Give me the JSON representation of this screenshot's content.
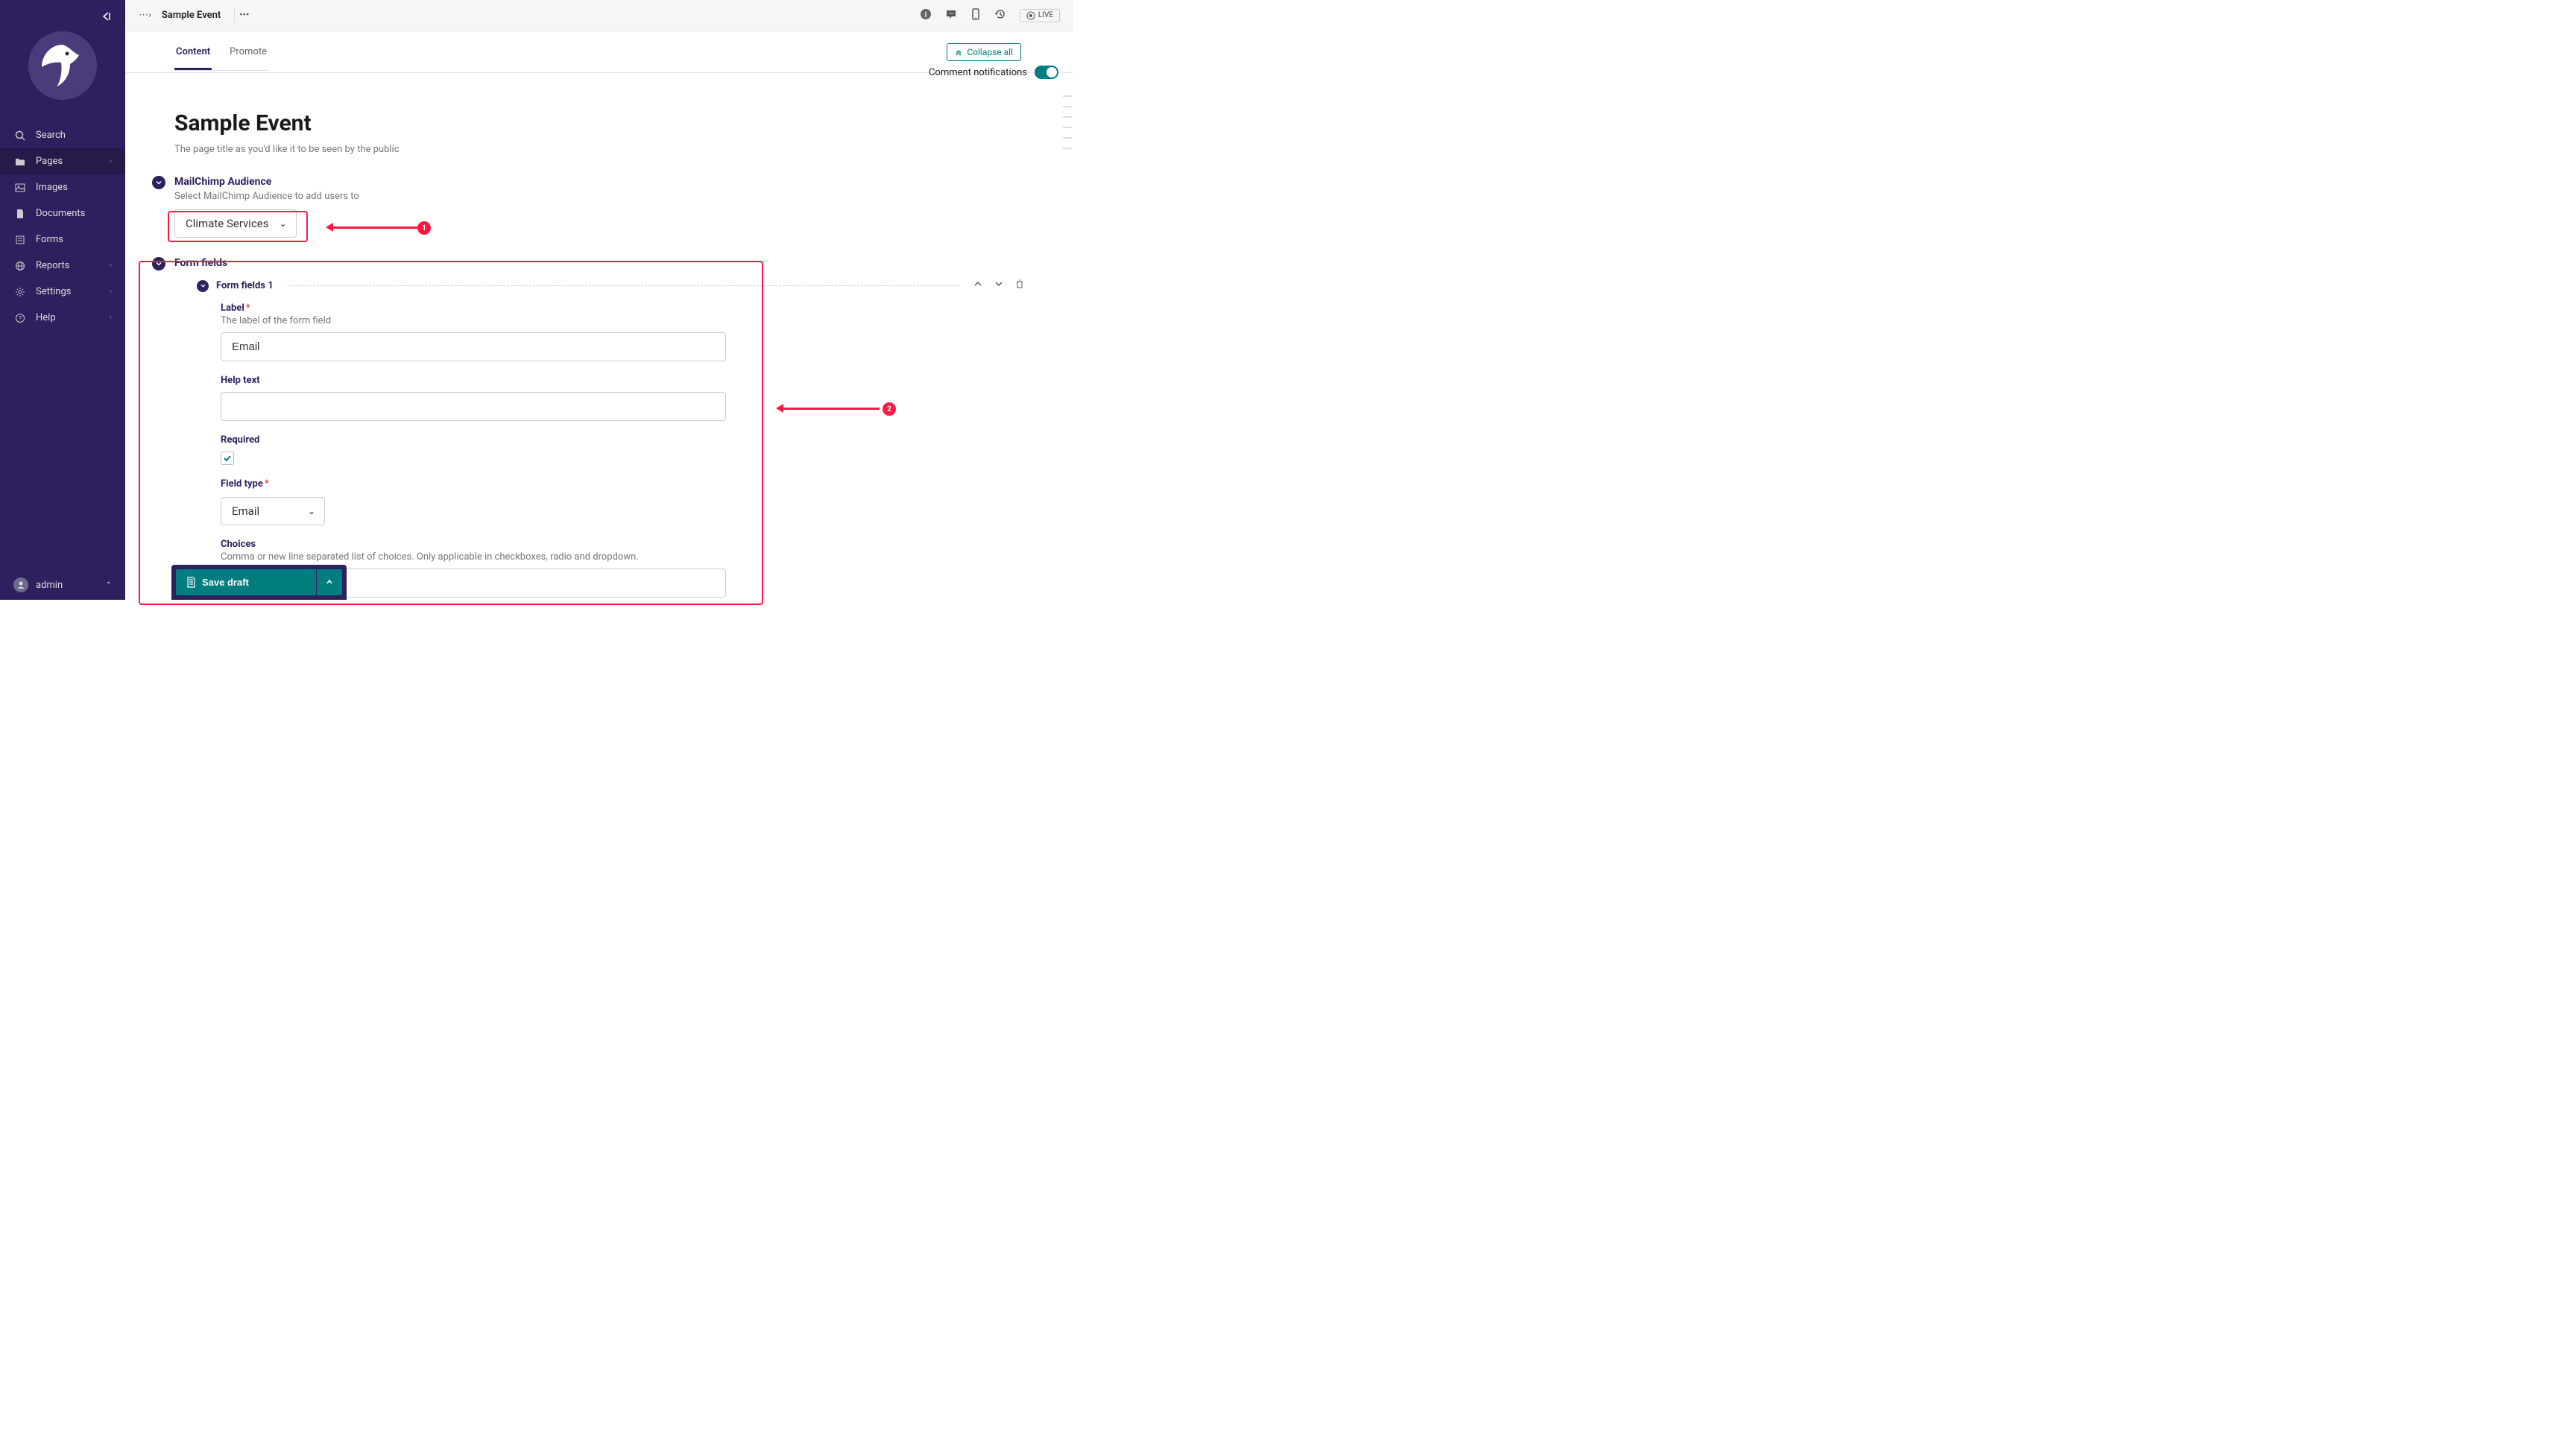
{
  "sidebar": {
    "collapse_hint": "←|",
    "nav": [
      {
        "label": "Search"
      },
      {
        "label": "Pages",
        "has_sub": true,
        "active": true
      },
      {
        "label": "Images"
      },
      {
        "label": "Documents"
      },
      {
        "label": "Forms"
      },
      {
        "label": "Reports",
        "has_sub": true
      },
      {
        "label": "Settings",
        "has_sub": true
      },
      {
        "label": "Help",
        "has_sub": true
      }
    ],
    "user": "admin"
  },
  "header": {
    "breadcrumb_root": "⋯›",
    "title": "Sample Event",
    "more": "•••",
    "live": "LIVE"
  },
  "tabs": {
    "items": [
      {
        "label": "Content",
        "active": true
      },
      {
        "label": "Promote"
      }
    ],
    "collapse_all": "Collapse all",
    "notif_label": "Comment notifications"
  },
  "page": {
    "title": "Sample Event",
    "subtitle": "The page title as you'd like it to be seen by the public"
  },
  "mailchimp": {
    "title": "MailChimp Audience",
    "help": "Select MailChimp Audience to add users to",
    "selected": "Climate Services"
  },
  "formfields": {
    "title": "Form fields",
    "block_title": "Form fields 1",
    "label": {
      "label": "Label",
      "help": "The label of the form field",
      "value": "Email"
    },
    "helptext": {
      "label": "Help text",
      "value": ""
    },
    "required": {
      "label": "Required",
      "checked": true
    },
    "fieldtype": {
      "label": "Field type",
      "selected": "Email"
    },
    "choices": {
      "label": "Choices",
      "help": "Comma or new line separated list of choices. Only applicable in checkboxes, radio and dropdown."
    }
  },
  "footer": {
    "save": "Save draft"
  },
  "annotations": {
    "a1": "1",
    "a2": "2"
  }
}
